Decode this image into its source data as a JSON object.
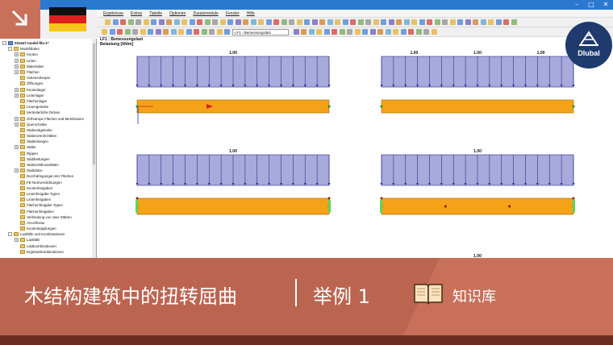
{
  "window": {
    "minimize": "–",
    "maximize": "□",
    "close": "✕"
  },
  "menu": [
    "Ergebnisse",
    "Extras",
    "Tabelle",
    "Optionen",
    "Zusatzmodule",
    "Fenster",
    "Hilfe"
  ],
  "toolbar": {
    "loadcase": "LF1 - Bemessungslast"
  },
  "navigator": {
    "project": "001647-model-file-1*",
    "items": [
      {
        "label": "Modelldaten",
        "level": 1,
        "exp": "-"
      },
      {
        "label": "Knoten",
        "level": 2,
        "exp": "+"
      },
      {
        "label": "Linien",
        "level": 2,
        "exp": "+"
      },
      {
        "label": "Materialien",
        "level": 2,
        "exp": "+"
      },
      {
        "label": "Flächen",
        "level": 2,
        "exp": "+"
      },
      {
        "label": "Volumenkörper",
        "level": 2,
        "exp": ""
      },
      {
        "label": "Öffnungen",
        "level": 2,
        "exp": ""
      },
      {
        "label": "Knotenlager",
        "level": 2,
        "exp": "+"
      },
      {
        "label": "Linienlager",
        "level": 2,
        "exp": "+"
      },
      {
        "label": "Flächenlager",
        "level": 2,
        "exp": ""
      },
      {
        "label": "Liniengelenke",
        "level": 2,
        "exp": ""
      },
      {
        "label": "Veränderliche Dicken",
        "level": 2,
        "exp": ""
      },
      {
        "label": "Orthotrope Flächen und Membranen",
        "level": 2,
        "exp": "+"
      },
      {
        "label": "Querschnitte",
        "level": 2,
        "exp": "+"
      },
      {
        "label": "Stabendgelenke",
        "level": 2,
        "exp": ""
      },
      {
        "label": "Stabexzentrizitäten",
        "level": 2,
        "exp": ""
      },
      {
        "label": "Stabteilungen",
        "level": 2,
        "exp": ""
      },
      {
        "label": "Stäbe",
        "level": 2,
        "exp": "+"
      },
      {
        "label": "Rippen",
        "level": 2,
        "exp": ""
      },
      {
        "label": "Stabbettungen",
        "level": 2,
        "exp": ""
      },
      {
        "label": "Stabnichtlinearitäten",
        "level": 2,
        "exp": ""
      },
      {
        "label": "Stabsätze",
        "level": 2,
        "exp": "+"
      },
      {
        "label": "Durchdringungen der Flächen",
        "level": 2,
        "exp": ""
      },
      {
        "label": "FE-Netzverdichtungen",
        "level": 2,
        "exp": ""
      },
      {
        "label": "Knotenfreigaben",
        "level": 2,
        "exp": ""
      },
      {
        "label": "Linienfreigabe-Typen",
        "level": 2,
        "exp": ""
      },
      {
        "label": "Linienfreigaben",
        "level": 2,
        "exp": ""
      },
      {
        "label": "Flächenfreigabe-Typen",
        "level": 2,
        "exp": ""
      },
      {
        "label": "Flächenfreigaben",
        "level": 2,
        "exp": ""
      },
      {
        "label": "Verbindung von zwei Stäben",
        "level": 2,
        "exp": ""
      },
      {
        "label": "Anschlüsse",
        "level": 2,
        "exp": ""
      },
      {
        "label": "Knotenkopplungen",
        "level": 2,
        "exp": ""
      },
      {
        "label": "Lastfälle und Kombinationen",
        "level": 1,
        "exp": "-"
      },
      {
        "label": "Lastfälle",
        "level": 2,
        "exp": "+"
      },
      {
        "label": "Lastkombinationen",
        "level": 2,
        "exp": ""
      },
      {
        "label": "Ergebniskombinationen",
        "level": 2,
        "exp": ""
      }
    ]
  },
  "workspace": {
    "title": "LF1 : Bemessungslast",
    "subtitle": "Belastung [kN/m]",
    "panels": [
      {
        "load_labels": [
          "1.00"
        ]
      },
      {
        "load_labels": [
          "1.00",
          "1.00",
          "1.00"
        ]
      },
      {
        "load_labels": [
          "1.00"
        ]
      },
      {
        "load_labels": [
          "1.00"
        ]
      },
      {
        "load_labels": [
          "1.00"
        ]
      }
    ]
  },
  "brand": {
    "name": "Dlubal"
  },
  "banner": {
    "title": "木结构建筑中的扭转屈曲",
    "subtitle": "举例 1",
    "knowledge_base": "知识库"
  },
  "colors": {
    "banner": "#c8705a",
    "banner_dark": "#6a2e20",
    "load_fill": "#a8aadb",
    "load_stroke": "#2e2f8a",
    "member_fill": "#f5a219",
    "dlubal_blue": "#1f3a6d"
  }
}
